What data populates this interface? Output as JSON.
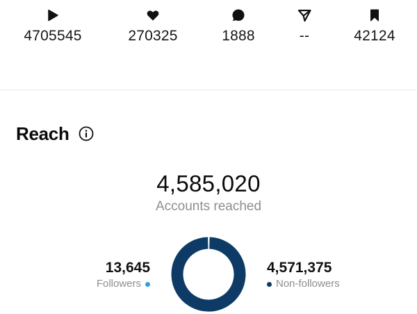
{
  "stats": [
    {
      "icon": "play-icon",
      "value": "4705545"
    },
    {
      "icon": "heart-icon",
      "value": "270325"
    },
    {
      "icon": "comment-icon",
      "value": "1888"
    },
    {
      "icon": "share-icon",
      "value": "--"
    },
    {
      "icon": "bookmark-icon",
      "value": "42124"
    }
  ],
  "reach": {
    "title": "Reach",
    "info_icon": "info-icon",
    "total": "4,585,020",
    "total_label": "Accounts reached",
    "followers": {
      "value": "13,645",
      "label": "Followers",
      "color": "#2f9fe0"
    },
    "non_followers": {
      "value": "4,571,375",
      "label": "Non-followers",
      "color": "#0d3b66"
    }
  },
  "chart_data": {
    "type": "pie",
    "categories": [
      "Followers",
      "Non-followers"
    ],
    "values": [
      13645,
      4571375
    ],
    "colors": [
      "#2f9fe0",
      "#0d3b66"
    ]
  }
}
